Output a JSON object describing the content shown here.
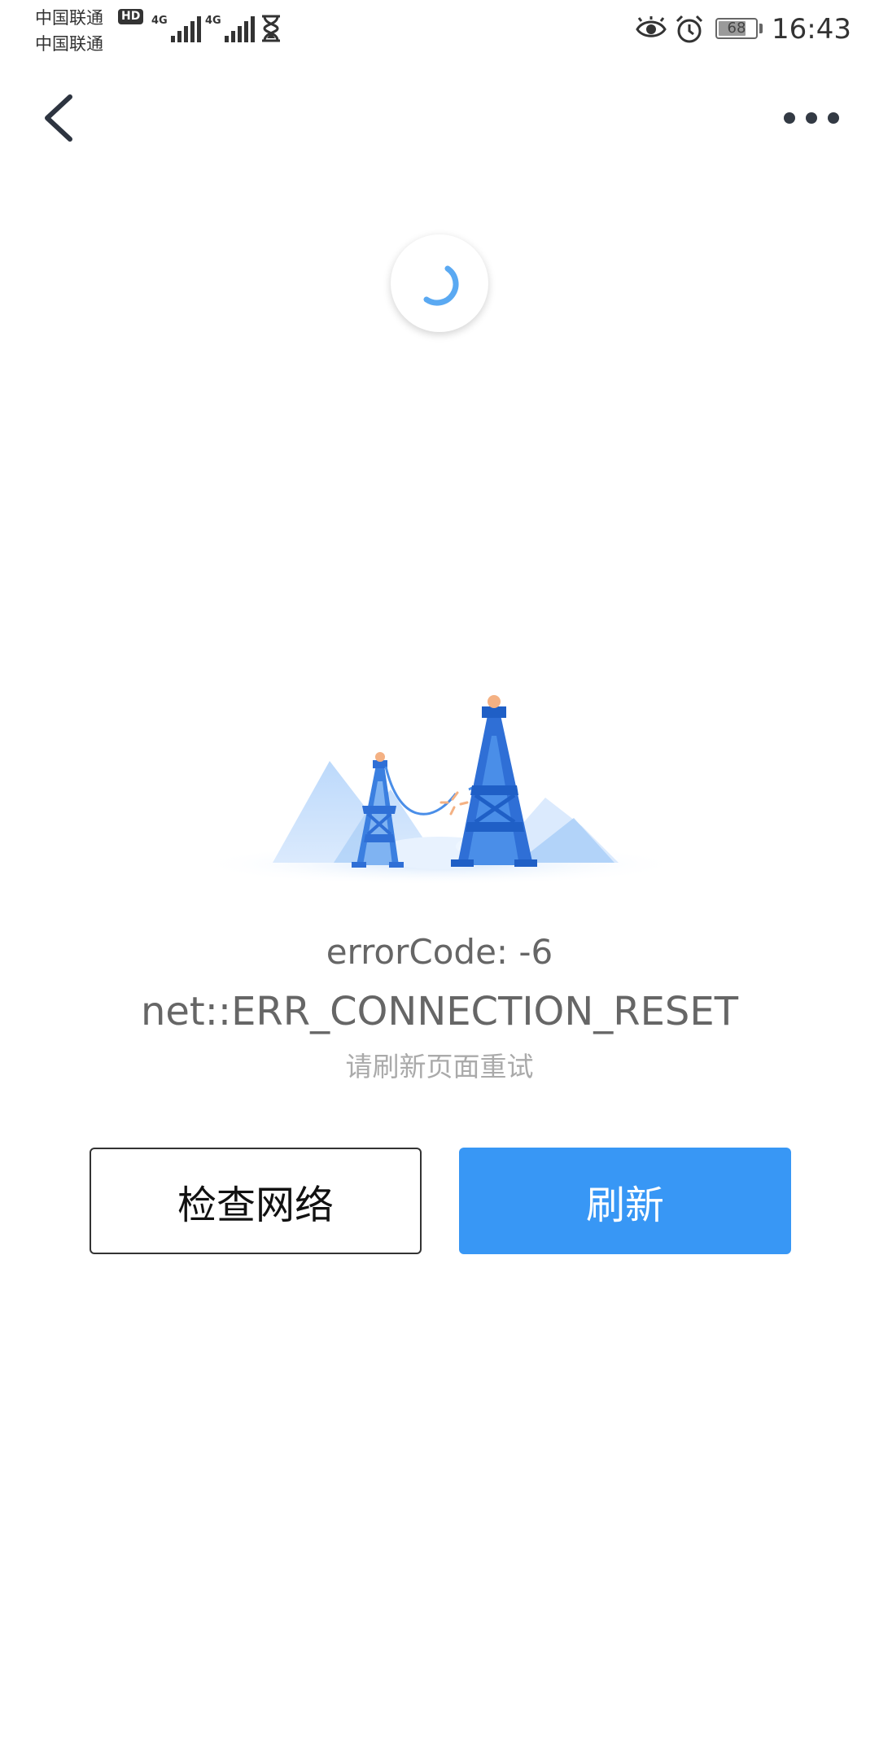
{
  "status_bar": {
    "carrier_1": "中国联通",
    "carrier_2": "中国联通",
    "hd_badge": "HD",
    "signal_1_label": "4G",
    "signal_2_label": "4G",
    "battery_level": "68",
    "time": "16:43"
  },
  "nav": {
    "back_icon": "chevron-left-icon",
    "more_icon": "more-horizontal-icon"
  },
  "error": {
    "code": "errorCode: -6",
    "name": "net::ERR_CONNECTION_RESET",
    "hint": "请刷新页面重试"
  },
  "actions": {
    "check_network": "检查网络",
    "refresh": "刷新"
  },
  "colors": {
    "accent": "#3897f5",
    "illustration_dark": "#2f6fd6",
    "illustration_light": "#a8cdf7"
  }
}
